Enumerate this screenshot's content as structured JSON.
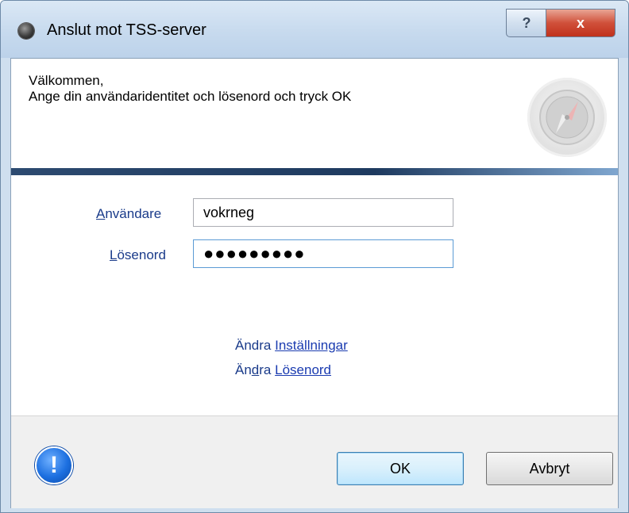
{
  "window": {
    "title": "Anslut mot TSS-server",
    "help_glyph": "?",
    "close_glyph": "x"
  },
  "header": {
    "welcome_line1": "Välkommen,",
    "welcome_line2": "Ange din användaridentitet och lösenord och tryck OK",
    "icon": "compass-icon"
  },
  "form": {
    "user_label_accel": "A",
    "user_label_rest": "nvändare",
    "user_value": "vokrneg",
    "password_label_accel": "L",
    "password_label_rest": "ösenord",
    "password_value": "●●●●●●●●●"
  },
  "links": {
    "settings_prefix": "Ändra",
    "settings_link": "Inställningar",
    "password_prefix_start": "Än",
    "password_prefix_accel": "d",
    "password_prefix_end": "ra",
    "password_link": "Lösenord"
  },
  "footer": {
    "icon": "info-icon",
    "icon_glyph": "!",
    "ok_label": "OK",
    "cancel_label": "Avbryt"
  },
  "colors": {
    "label": "#1a3b8a",
    "link": "#1a3bb0",
    "divider": "#1e3a5f",
    "close_button": "#c0311c"
  }
}
